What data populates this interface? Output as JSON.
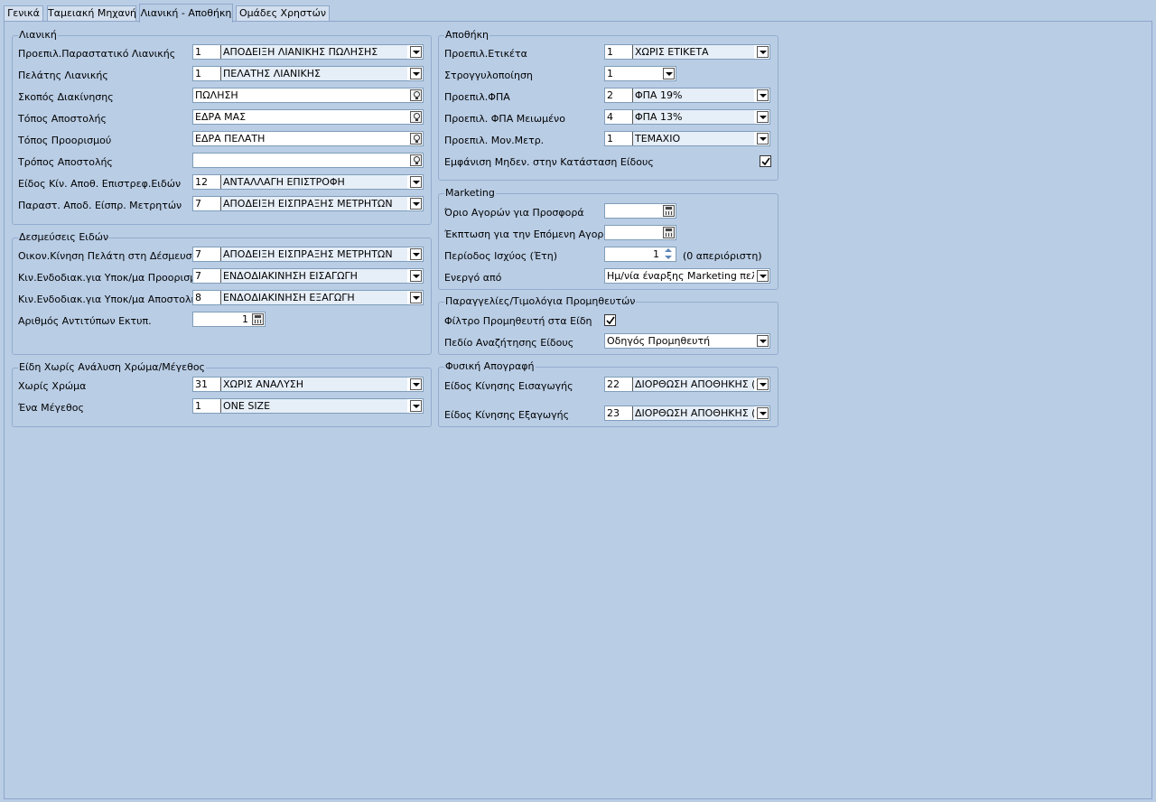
{
  "tabs": [
    "Γενικά",
    "Ταμειακή Μηχανή",
    "Λιανική - Αποθήκη",
    "Ομάδες Χρηστών"
  ],
  "active_tab": "Λιανική - Αποθήκη",
  "retail": {
    "title": "Λιανική",
    "rows": [
      {
        "label": "Προεπιλ.Παραστατικό Λιανικής",
        "code": "1",
        "value": "ΑΠΟΔΕΙΞΗ ΛΙΑΝΙΚΗΣ ΠΩΛΗΣΗΣ"
      },
      {
        "label": "Πελάτης Λιανικής",
        "code": "1",
        "value": "ΠΕΛΑΤΗΣ ΛΙΑΝΙΚΗΣ"
      },
      {
        "label": "Σκοπός Διακίνησης",
        "value": "ΠΩΛΗΣΗ"
      },
      {
        "label": "Τόπος Αποστολής",
        "value": "ΕΔΡΑ ΜΑΣ"
      },
      {
        "label": "Τόπος Προορισμού",
        "value": "ΕΔΡΑ ΠΕΛΑΤΗ"
      },
      {
        "label": "Τρόπος Αποστολής",
        "value": ""
      },
      {
        "label": "Είδος Κίν. Αποθ. Επιστρεφ.Ειδών",
        "code": "12",
        "value": "ΑΝΤΑΛΛΑΓΗ ΕΠΙΣΤΡΟΦΗ"
      },
      {
        "label": "Παραστ. Αποδ. Είσπρ. Μετρητών",
        "code": "7",
        "value": "ΑΠΟΔΕΙΞΗ ΕΙΣΠΡΑΞΗΣ ΜΕΤΡΗΤΩΝ"
      }
    ]
  },
  "commitments": {
    "title": "Δεσμεύσεις Ειδών",
    "rows": [
      {
        "label": "Οικον.Κίνηση Πελάτη στη Δέσμευση",
        "code": "7",
        "value": "ΑΠΟΔΕΙΞΗ ΕΙΣΠΡΑΞΗΣ ΜΕΤΡΗΤΩΝ"
      },
      {
        "label": "Κιν.Ενδοδιακ.για Υποκ/μα Προορισμ.",
        "code": "7",
        "value": "ΕΝΔΟΔΙΑΚΙΝΗΣΗ ΕΙΣΑΓΩΓΗ"
      },
      {
        "label": "Κιν.Ενδοδιακ.για Υποκ/μα Αποστολής",
        "code": "8",
        "value": "ΕΝΔΟΔΙΑΚΙΝΗΣΗ ΕΞΑΓΩΓΗ"
      }
    ],
    "copies_label": "Αριθμός Αντιτύπων Εκτυπ.",
    "copies_value": "1"
  },
  "no_color_size": {
    "title": "Είδη Χωρίς Ανάλυση Χρώμα/Μέγεθος",
    "rows": [
      {
        "label": "Χωρίς Χρώμα",
        "code": "31",
        "value": "ΧΩΡΙΣ ΑΝΑΛΥΣΗ"
      },
      {
        "label": "Ένα Μέγεθος",
        "code": "1",
        "value": "ONE SIZE"
      }
    ]
  },
  "warehouse": {
    "title": "Αποθήκη",
    "label_row": {
      "label": "Προεπιλ.Ετικέτα",
      "code": "1",
      "value": "ΧΩΡΙΣ ΕΤΙΚΕΤΑ"
    },
    "rounding_row": {
      "label": "Στρογγυλοποίηση",
      "value": "1"
    },
    "vat_row": {
      "label": "Προεπιλ.ΦΠΑ",
      "code": "2",
      "value": "ΦΠΑ 19%"
    },
    "vat_reduced_row": {
      "label": "Προεπιλ. ΦΠΑ Μειωμένο",
      "code": "4",
      "value": "ΦΠΑ 13%"
    },
    "unit_row": {
      "label": "Προεπιλ. Μον.Μετρ.",
      "code": "1",
      "value": "ΤΕΜΑΧΙΟ"
    },
    "zero_label": "Εμφάνιση Μηδεν. στην Κατάσταση Είδους",
    "zero_checked": true
  },
  "marketing": {
    "title": "Marketing",
    "purchase_limit_label": "Όριο Αγορών για Προσφορά",
    "purchase_limit_value": "",
    "discount_label": "Έκπτωση για την Επόμενη Αγορά",
    "discount_value": "",
    "period_label": "Περίοδος Ισχύος (Έτη)",
    "period_value": "1",
    "period_note": "(0 απεριόριστη)",
    "active_from_label": "Ενεργό από",
    "active_from_value": "Ημ/νία έναρξης Marketing πελάτη"
  },
  "supplier_orders": {
    "title": "Παραγγελίες/Τιμολόγια Προμηθευτών",
    "filter_label": "Φίλτρο Προμηθευτή στα Είδη",
    "filter_checked": true,
    "search_label": "Πεδίο Αναζήτησης Είδους",
    "search_value": "Οδηγός Προμηθευτή"
  },
  "physical_inventory": {
    "title": "Φυσική Απογραφή",
    "in_row": {
      "label": "Είδος Κίνησης Εισαγωγής",
      "code": "22",
      "value": "ΔΙΟΡΘΩΣΗ ΑΠΟΘΗΚΗΣ (ΧΡΕ"
    },
    "out_row": {
      "label": "Είδος Κίνησης Εξαγωγής",
      "code": "23",
      "value": "ΔΙΟΡΘΩΣΗ ΑΠΟΘΗΚΗΣ (ΠΙΣ"
    }
  },
  "colors": {
    "background": "#b9cde5",
    "border": "#8ea7c9"
  }
}
